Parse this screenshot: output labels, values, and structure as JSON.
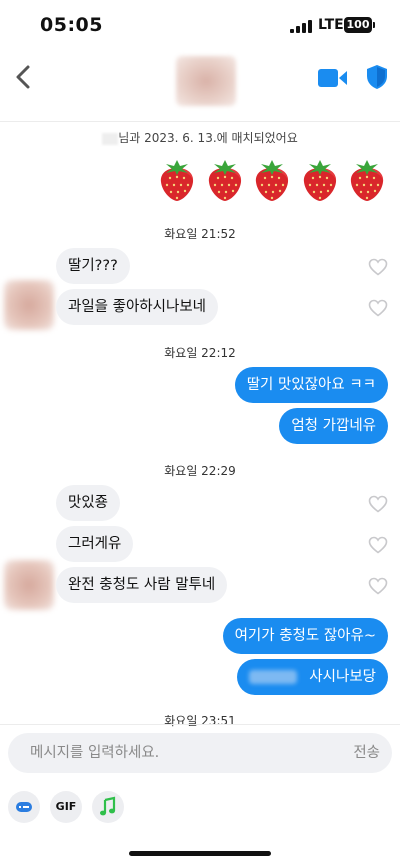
{
  "status_bar": {
    "time": "05:05",
    "network": "LTE",
    "battery": "100"
  },
  "header": {
    "back_icon": "chevron-left-icon",
    "video_icon": "video-camera-icon",
    "safety_icon": "shield-icon",
    "accent_color": "#1a8cf0"
  },
  "conversation": {
    "match_notice": "님과 2023. 6. 13.에 매치되었어요",
    "sticker_icon": "strawberry-icon",
    "groups": [
      {
        "timestamp": "화요일 21:52",
        "messages": [
          {
            "side": "in",
            "text": "딸기???"
          },
          {
            "side": "in",
            "text": "과일을 좋아하시나보네"
          }
        ]
      },
      {
        "timestamp": "화요일 22:12",
        "messages": [
          {
            "side": "out",
            "text": "딸기 맛있잖아요 ㅋㅋ"
          },
          {
            "side": "out",
            "text": "엄청 가깝네유"
          }
        ]
      },
      {
        "timestamp": "화요일 22:29",
        "messages": [
          {
            "side": "in",
            "text": "맛있죵"
          },
          {
            "side": "in",
            "text": "그러게유"
          },
          {
            "side": "in",
            "text": "완전 충청도 사람 말투네"
          },
          {
            "side": "out",
            "text": "여기가 충청도 잖아유~"
          },
          {
            "side": "out",
            "text": "사시나보당"
          }
        ]
      },
      {
        "timestamp": "화요일 23:51",
        "messages": []
      }
    ]
  },
  "composer": {
    "placeholder": "메시지를 입력하세요.",
    "send_label": "전송",
    "gif_label": "GIF",
    "attachments": [
      "emoji-badge-icon",
      "gif-icon",
      "music-note-icon"
    ]
  }
}
